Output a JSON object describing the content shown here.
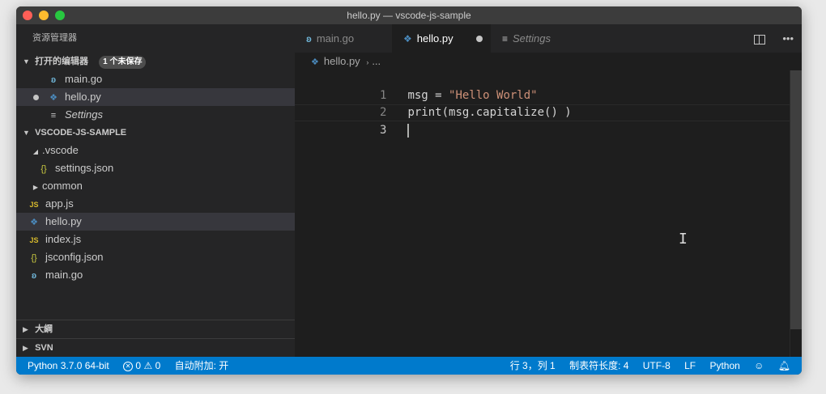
{
  "window": {
    "title": "hello.py — vscode-js-sample"
  },
  "sidebar": {
    "title": "资源管理器",
    "open_editors": {
      "header": "打开的编辑器",
      "badge": "1 个未保存",
      "items": [
        {
          "label": "main.go",
          "icon": "go-icon",
          "dirty": false,
          "italic": false
        },
        {
          "label": "hello.py",
          "icon": "python-icon",
          "dirty": true,
          "italic": false
        },
        {
          "label": "Settings",
          "icon": "settings-list-icon",
          "dirty": false,
          "italic": true
        }
      ]
    },
    "workspace": {
      "header": "VSCODE-JS-SAMPLE",
      "items": [
        {
          "label": ".vscode",
          "icon": "folder-open-arrow"
        },
        {
          "label": "settings.json",
          "icon": "json-icon"
        },
        {
          "label": "common",
          "icon": "folder-closed-arrow"
        },
        {
          "label": "app.js",
          "icon": "js-icon"
        },
        {
          "label": "hello.py",
          "icon": "python-icon"
        },
        {
          "label": "index.js",
          "icon": "js-icon"
        },
        {
          "label": "jsconfig.json",
          "icon": "json-icon"
        },
        {
          "label": "main.go",
          "icon": "go-icon"
        }
      ]
    },
    "outline": {
      "header": "大綱"
    },
    "svn": {
      "header": "SVN"
    }
  },
  "editor": {
    "tabs": [
      {
        "label": "main.go",
        "icon": "go-icon"
      },
      {
        "label": "hello.py",
        "icon": "python-icon",
        "active": true,
        "dirty": true
      },
      {
        "label": "Settings",
        "icon": "settings-list-icon"
      }
    ],
    "breadcrumb": {
      "file": "hello.py",
      "more": "..."
    },
    "lines": [
      {
        "num": "1",
        "code_a": "msg = ",
        "code_b": "\"Hello World\""
      },
      {
        "num": "2",
        "code_a": "print(msg.capitalize() )",
        "code_b": ""
      },
      {
        "num": "3",
        "code_a": "",
        "code_b": ""
      }
    ]
  },
  "statusbar": {
    "interpreter": "Python 3.7.0 64-bit",
    "errors": "0",
    "warnings": "0",
    "auto_attach": "自动附加: 开",
    "position": "行 3，列 1",
    "tab_size": "制表符长度: 4",
    "encoding": "UTF-8",
    "eol": "LF",
    "language": "Python"
  },
  "colors": {
    "statusbar_bg": "#007acc",
    "editor_bg": "#1e1e1e",
    "sidebar_bg": "#252526",
    "string": "#ce9178"
  }
}
